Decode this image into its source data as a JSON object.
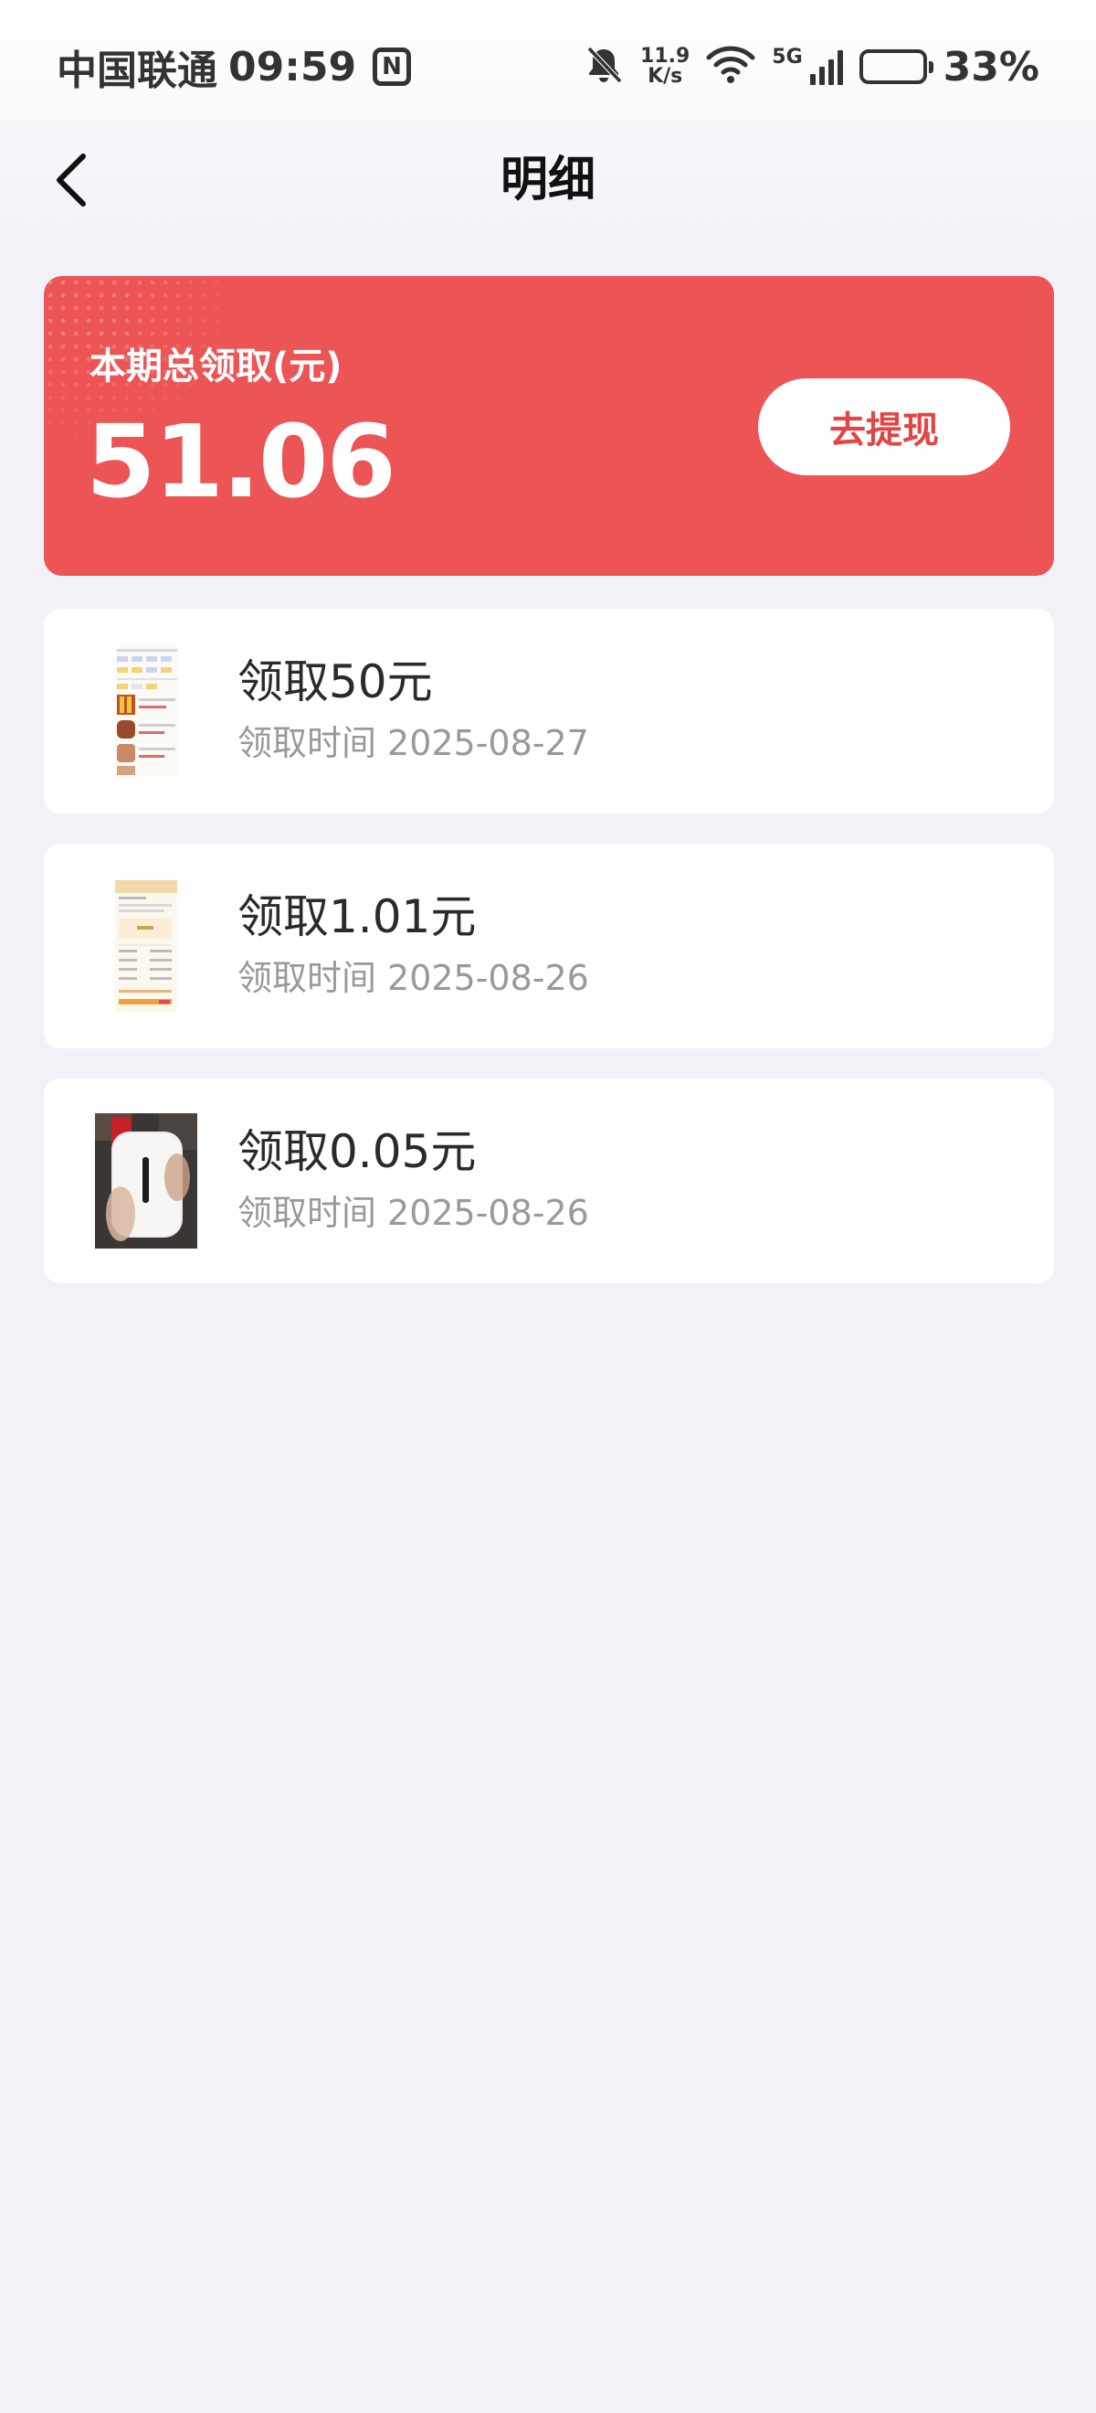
{
  "status_bar": {
    "carrier": "中国联通",
    "time": "09:59",
    "nfc_label": "N",
    "net_speed_value": "11.9",
    "net_speed_unit": "K/s",
    "network_type": "5G",
    "battery_percent": "33%",
    "battery_level": 0.33
  },
  "nav": {
    "title": "明细"
  },
  "summary": {
    "label": "本期总领取(元)",
    "amount": "51.06",
    "withdraw_label": "去提现",
    "accent_color": "#ec5455"
  },
  "records": [
    {
      "title": "领取50元",
      "time_label": "领取时间",
      "date": "2025-08-27",
      "thumbnail": "app-screenshot-thumbnail"
    },
    {
      "title": "领取1.01元",
      "time_label": "领取时间",
      "date": "2025-08-26",
      "thumbnail": "receipt-thumbnail"
    },
    {
      "title": "领取0.05元",
      "time_label": "领取时间",
      "date": "2025-08-26",
      "thumbnail": "device-photo-thumbnail"
    }
  ]
}
